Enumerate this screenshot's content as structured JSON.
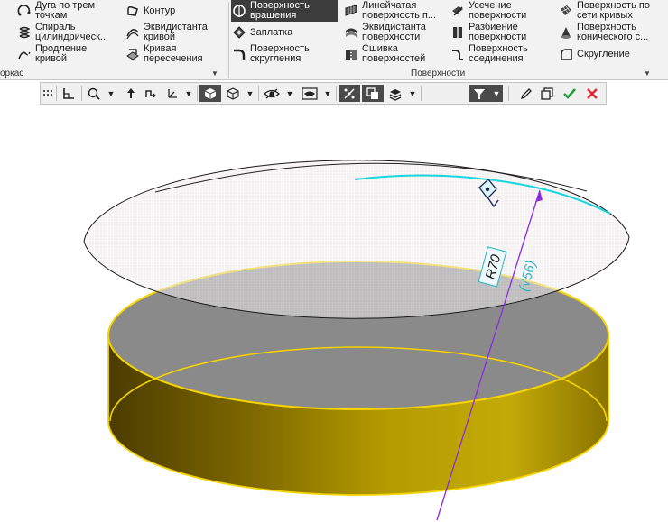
{
  "ribbon": {
    "col1": [
      {
        "label": "Дуга по трем\nточкам",
        "icon": "arc-three-points-icon"
      },
      {
        "label": "Спираль\nцилиндрическ...",
        "icon": "cylindrical-spiral-icon"
      },
      {
        "label": "Продление\nкривой",
        "icon": "extend-curve-icon"
      }
    ],
    "col2": [
      {
        "label": "Контур",
        "icon": "contour-icon"
      },
      {
        "label": "Эквидистанта\nкривой",
        "icon": "curve-offset-icon"
      },
      {
        "label": "Кривая\nпересечения",
        "icon": "intersection-curve-icon"
      }
    ],
    "col3": [
      {
        "label": "Поверхность\nвращения",
        "icon": "revolution-surface-icon"
      },
      {
        "label": "Заплатка",
        "icon": "patch-icon"
      },
      {
        "label": "Поверхность\nскругления",
        "icon": "fillet-surface-icon"
      }
    ],
    "col4": [
      {
        "label": "Линейчатая\nповерхность п...",
        "icon": "ruled-surface-icon"
      },
      {
        "label": "Эквидистанта\nповерхности",
        "icon": "surface-offset-icon"
      },
      {
        "label": "Сшивка\nповерхностей",
        "icon": "stitch-surfaces-icon"
      }
    ],
    "col5": [
      {
        "label": "Усечение\nповерхности",
        "icon": "trim-surface-icon"
      },
      {
        "label": "Разбиение\nповерхности",
        "icon": "split-surface-icon"
      },
      {
        "label": "Поверхность\nсоединения",
        "icon": "blend-surface-icon"
      }
    ],
    "col6": [
      {
        "label": "Поверхность по\nсети кривых",
        "icon": "curve-network-surface-icon"
      },
      {
        "label": "Поверхность\nконического с...",
        "icon": "conic-surface-icon"
      },
      {
        "label": "Скругление",
        "icon": "fillet-icon"
      }
    ],
    "group_left_partial": "оркас",
    "group_surfaces": "Поверхности"
  },
  "scene": {
    "dimension_radius": "R70",
    "dimension_value": "(√56)",
    "colors": {
      "cylinder_gold": "#b89c00",
      "edge_yellow": "#f5d400",
      "axis_purple": "#8a2be2",
      "curve_cyan": "#18d6e0",
      "dimension_teal": "#2ab3c7"
    }
  }
}
